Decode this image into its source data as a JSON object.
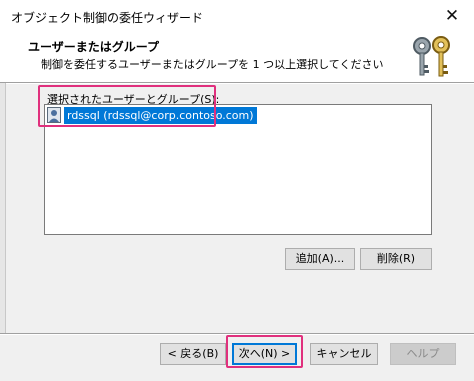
{
  "window": {
    "title": "オブジェクト制御の委任ウィザード",
    "close_glyph": "✕"
  },
  "header": {
    "title": "ユーザーまたはグループ",
    "subtitle": "制御を委任するユーザーまたはグループを 1 つ以上選択してください",
    "icon": "keys-icon"
  },
  "selected_list": {
    "label": "選択されたユーザーとグループ(S):",
    "items": [
      {
        "text": "rdssql (rdssql@corp.contoso.com)",
        "icon": "user-icon",
        "selected": true
      }
    ]
  },
  "list_buttons": {
    "add_label": "追加(A)...",
    "remove_label": "削除(R)"
  },
  "footer": {
    "back_label": "< 戻る(B)",
    "next_label": "次へ(N) >",
    "cancel_label": "キャンセル",
    "help_label": "ヘルプ"
  },
  "colors": {
    "selection": "#0078d7",
    "highlight_annotation": "#e0307d",
    "default_button_border": "#0078d7"
  }
}
